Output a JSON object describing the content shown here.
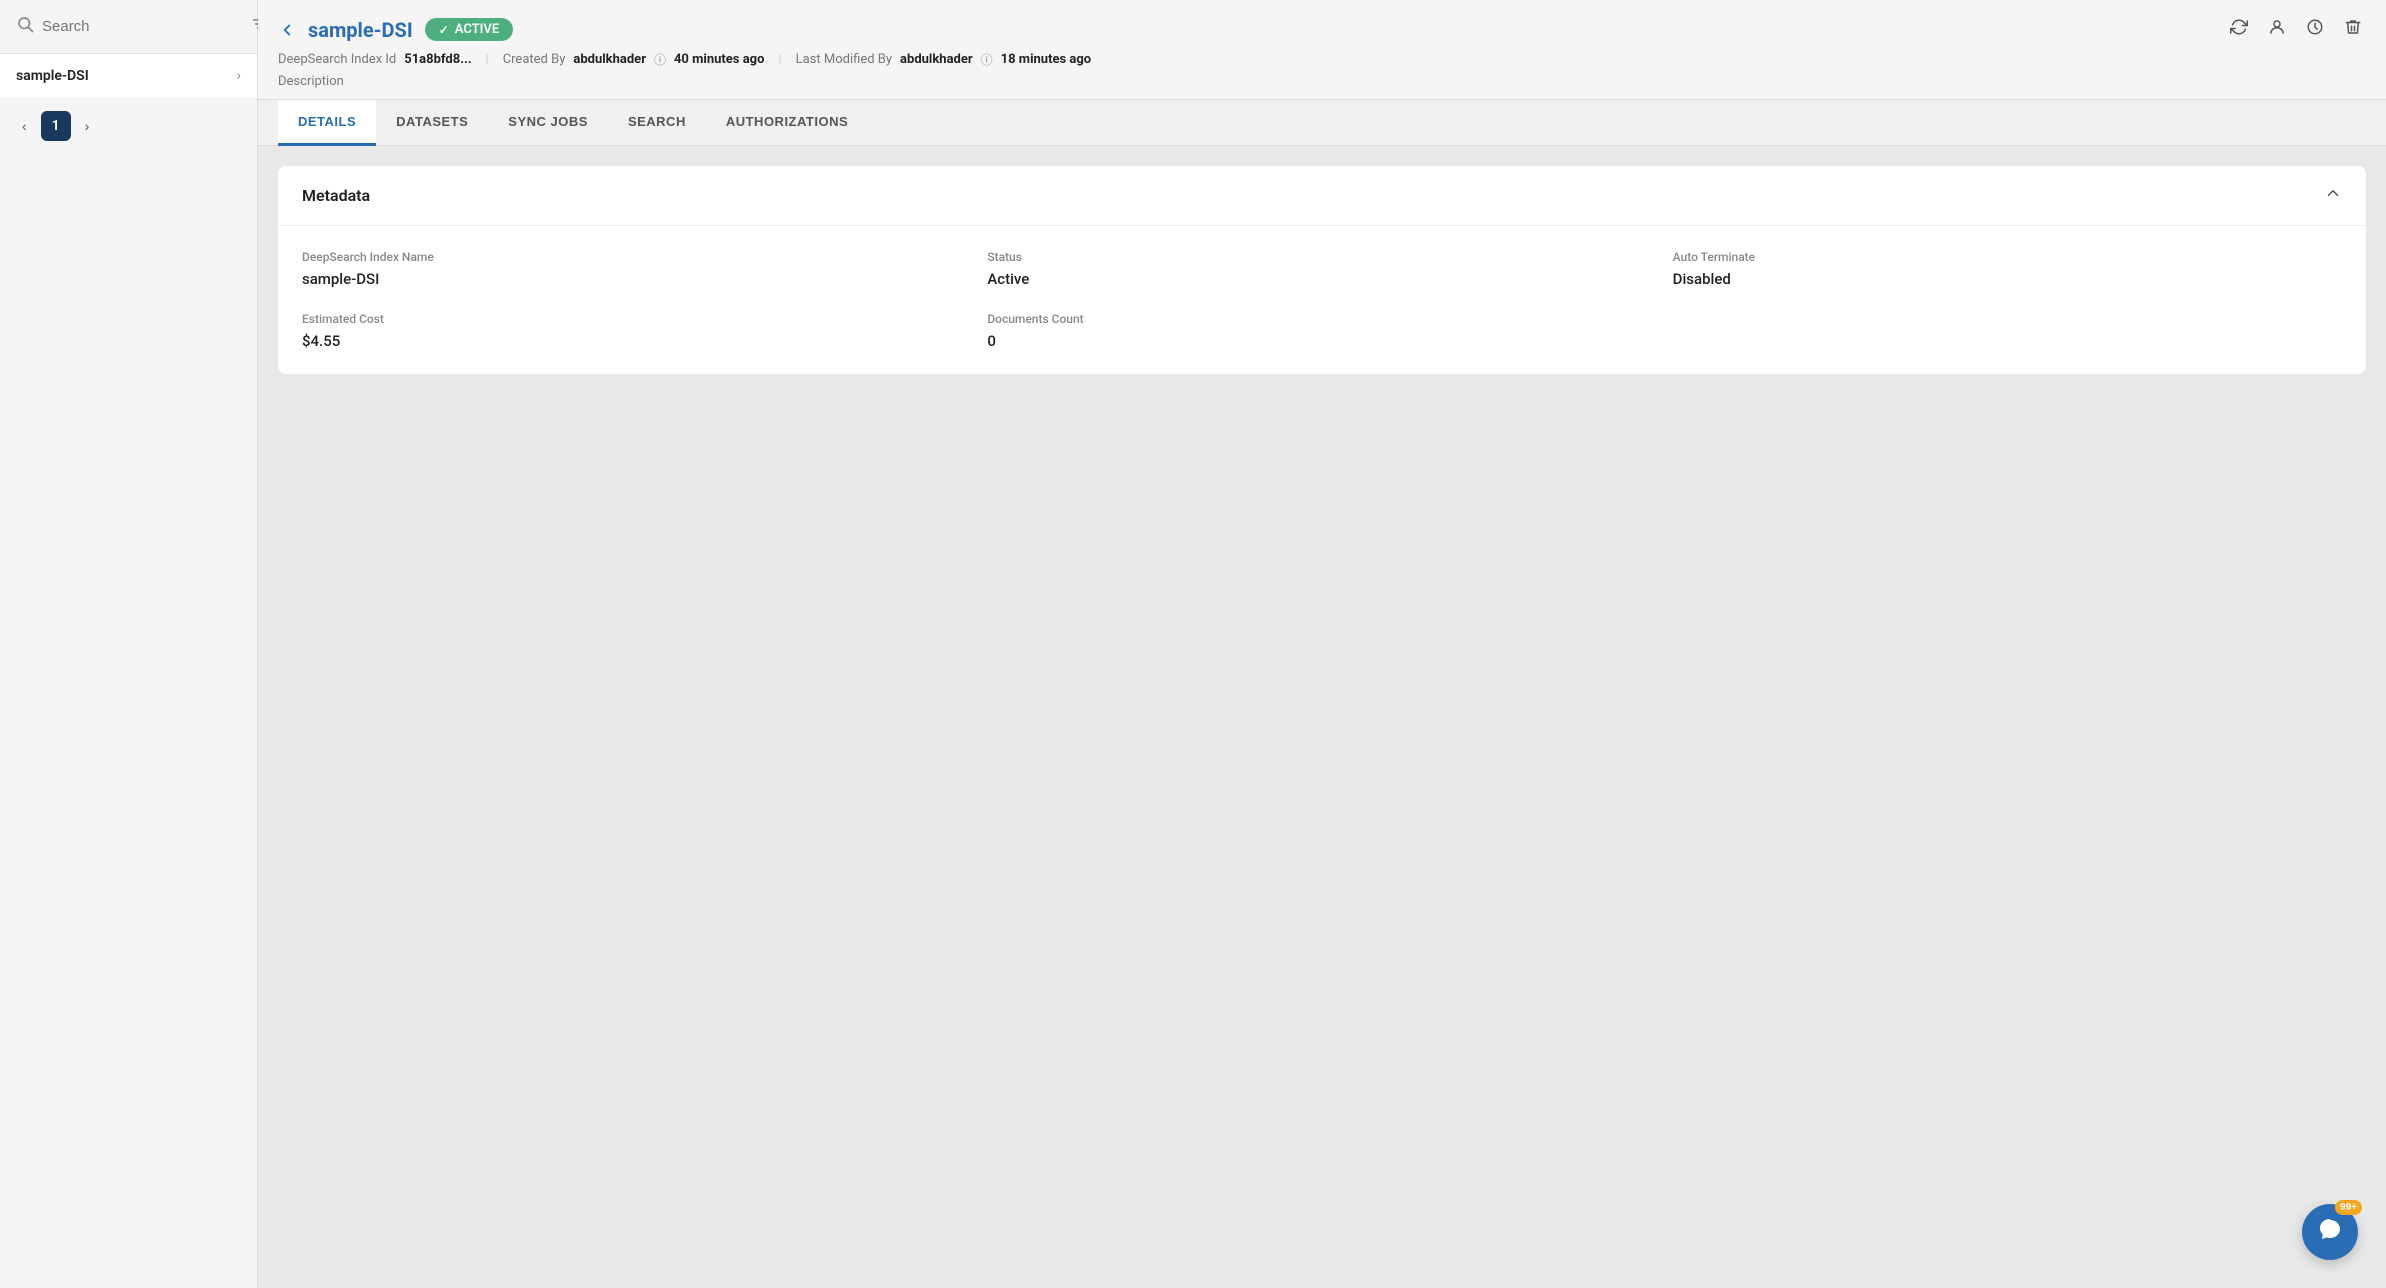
{
  "sidebar": {
    "search_placeholder": "Search",
    "items": [
      {
        "name": "sample-DSI"
      }
    ],
    "pagination": {
      "current_page": 1
    }
  },
  "header": {
    "back_label": "‹",
    "title": "sample-DSI",
    "status": "ACTIVE",
    "status_check": "✓",
    "meta": {
      "index_id_label": "DeepSearch Index Id",
      "index_id_value": "51a8bfd8...",
      "created_by_label": "Created By",
      "created_by_value": "abdulkhader",
      "created_time": "40 minutes ago",
      "last_modified_label": "Last Modified By",
      "last_modified_value": "abdulkhader",
      "last_modified_time": "18 minutes ago"
    },
    "description_label": "Description",
    "actions": {
      "refresh": "↻",
      "history": "◷",
      "clock": "🕐",
      "delete": "🗑"
    }
  },
  "tabs": [
    {
      "id": "details",
      "label": "DETAILS",
      "active": true
    },
    {
      "id": "datasets",
      "label": "DATASETS",
      "active": false
    },
    {
      "id": "sync-jobs",
      "label": "SYNC JOBS",
      "active": false
    },
    {
      "id": "search",
      "label": "SEARCH",
      "active": false
    },
    {
      "id": "authorizations",
      "label": "AUTHORIZATIONS",
      "active": false
    }
  ],
  "metadata_card": {
    "title": "Metadata",
    "fields": {
      "index_name_label": "DeepSearch Index Name",
      "index_name_value": "sample-DSI",
      "status_label": "Status",
      "status_value": "Active",
      "auto_terminate_label": "Auto Terminate",
      "auto_terminate_value": "Disabled",
      "estimated_cost_label": "Estimated Cost",
      "estimated_cost_value": "$4.55",
      "documents_count_label": "Documents Count",
      "documents_count_value": "0"
    }
  },
  "chat_fab": {
    "badge": "99+",
    "icon": "💬"
  }
}
